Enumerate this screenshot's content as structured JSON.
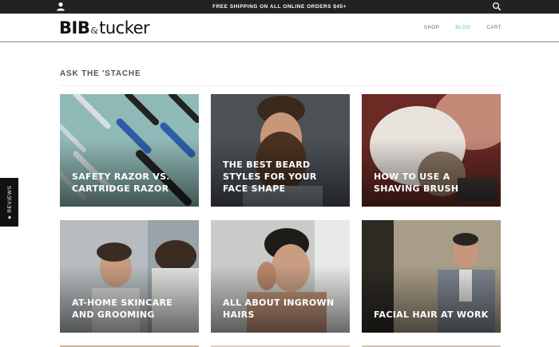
{
  "topbar": {
    "announcement": "FREE SHIPPING ON ALL ONLINE ORDERS $45+",
    "account_icon": "user-icon",
    "search_icon": "search-icon"
  },
  "header": {
    "logo_bib": "BIB",
    "logo_amp": "&",
    "logo_tucker": "tucker",
    "nav": [
      {
        "label": "SHOP"
      },
      {
        "label": "BLOG"
      },
      {
        "label": "CART"
      }
    ],
    "active_nav": "BLOG"
  },
  "main": {
    "section_title": "ASK THE 'STACHE",
    "posts": [
      {
        "title": "SAFETY RAZOR VS. CARTRIDGE RAZOR"
      },
      {
        "title": "THE BEST BEARD STYLES FOR YOUR FACE SHAPE"
      },
      {
        "title": "HOW TO USE A SHAVING BRUSH"
      },
      {
        "title": "AT-HOME SKINCARE AND GROOMING"
      },
      {
        "title": "ALL ABOUT INGROWN HAIRS"
      },
      {
        "title": "FACIAL HAIR AT WORK"
      }
    ]
  },
  "reviews_tab": {
    "label": "★ REVIEWS"
  },
  "colors": {
    "topbar_bg": "#222222",
    "accent": "#4fb6c8",
    "reviews_bg": "#111111"
  }
}
